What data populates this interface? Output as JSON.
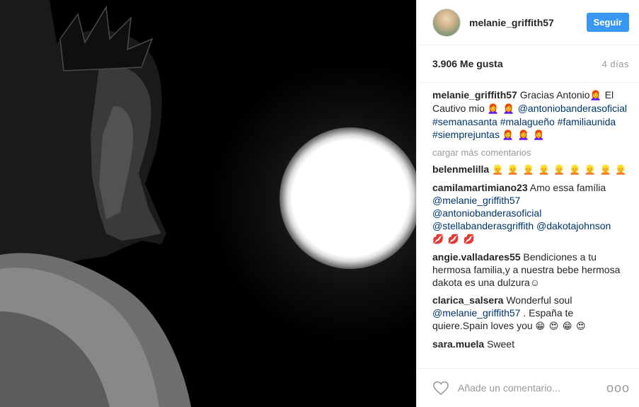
{
  "header": {
    "username": "melanie_griffith57",
    "follow_label": "Seguir"
  },
  "stats": {
    "likes": "3.906 Me gusta",
    "date": "4 días"
  },
  "caption": {
    "username": "melanie_griffith57",
    "text": "Gracias Antonio",
    "emoji_1": "👩‍🦰",
    "text_2": " El Cautivo mio ",
    "emoji_2": "👩‍🦰 👩‍🦰",
    "tags": "@antoniobanderasoficial #semanasanta #malagueño #familiaunida #siemprejuntas",
    "emoji_3": "👩‍🦰 👩‍🦰 👩‍🦰"
  },
  "load_more": "cargar más comentarios",
  "comments": [
    {
      "username": "belenmelilla",
      "text": "",
      "tags": "",
      "emoji": "👱 👱 👱 👱 👱 👱 👱 👱 👱"
    },
    {
      "username": "camilamartimiano23",
      "text": "Amo essa família",
      "tags": "@melanie_griffith57 @antoniobanderasoficial @stellabanderasgriffith @dakotajohnson",
      "emoji": "💋 💋 💋"
    },
    {
      "username": "angie.valladares55",
      "text": "Bendiciones a tu hermosa familia,y a nuestra bebe hermosa dakota es una dulzura☺",
      "tags": "",
      "emoji": ""
    },
    {
      "username": "clarica_salsera",
      "text": "Wonderful soul",
      "tags": "@melanie_griffith57",
      "text_2": " . España te quiere.Spain loves you ",
      "emoji": "😁 😍 😁 😍"
    },
    {
      "username": "sara.muela",
      "text": "Sweet",
      "tags": "",
      "emoji": ""
    }
  ],
  "footer": {
    "add_comment_placeholder": "Añade un comentario...",
    "more_options": "ooo"
  },
  "colors": {
    "accent": "#3897f0",
    "hashtag": "#003569",
    "muted": "#999999"
  },
  "icons": {
    "heart": "heart-icon",
    "more": "more-options-icon"
  }
}
